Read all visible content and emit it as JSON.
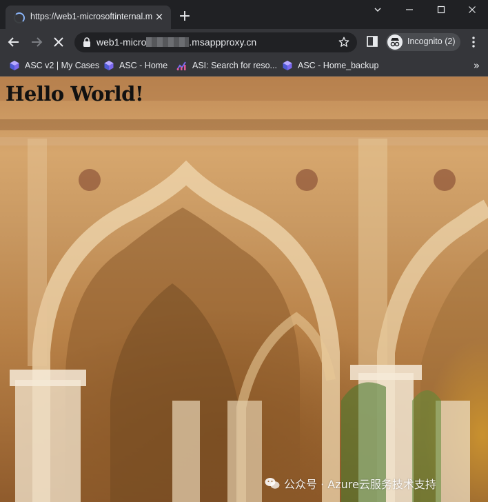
{
  "tab": {
    "title": "https://web1-microsoftinternal.m",
    "close_glyph": "×",
    "loading": true
  },
  "new_tab_glyph": "+",
  "address_bar": {
    "url_prefix": "web1-micro",
    "url_suffix": ".msappproxy.cn"
  },
  "profile": {
    "label": "Incognito (2)"
  },
  "bookmarks": [
    {
      "label": "ASC v2 | My Cases",
      "icon": "asc-cube-icon"
    },
    {
      "label": "ASC - Home",
      "icon": "asc-cube-icon"
    },
    {
      "label": "ASI: Search for reso...",
      "icon": "asi-chart-icon"
    },
    {
      "label": "ASC - Home_backup",
      "icon": "asc-cube-icon"
    }
  ],
  "bookmarks_overflow_glyph": "»",
  "page": {
    "heading": "Hello World!"
  },
  "watermark": {
    "text": "公众号 · Azure云服务技术支持"
  },
  "colors": {
    "chrome_dark": "#202124",
    "chrome_toolbar": "#35363a",
    "text": "#e8eaed",
    "spinner": "#8ab4f8"
  }
}
